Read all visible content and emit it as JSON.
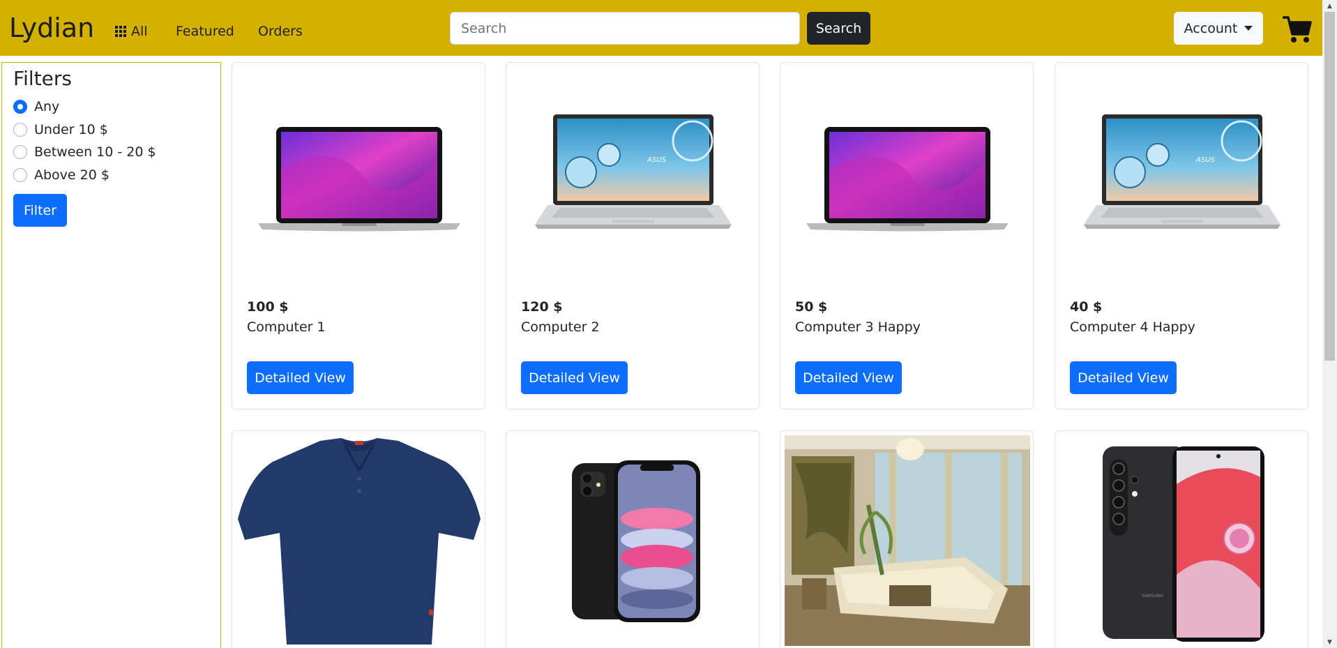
{
  "brand": "Lydian",
  "nav": {
    "all_label": "All",
    "featured_label": "Featured",
    "orders_label": "Orders"
  },
  "search": {
    "placeholder": "Search",
    "value": "",
    "button_label": "Search"
  },
  "account": {
    "label": "Account"
  },
  "icons": {
    "all": "grid-icon",
    "account_caret": "chevron-down-icon",
    "cart": "shopping-cart-icon"
  },
  "filters": {
    "title": "Filters",
    "options": [
      {
        "label": "Any",
        "checked": true
      },
      {
        "label": "Under 10 $",
        "checked": false
      },
      {
        "label": "Between 10 - 20 $",
        "checked": false
      },
      {
        "label": "Above 20 $",
        "checked": false
      }
    ],
    "button_label": "Filter"
  },
  "products": [
    {
      "price": "100 $",
      "name": "Computer 1",
      "button_label": "Detailed View",
      "image": "macbook"
    },
    {
      "price": "120 $",
      "name": "Computer 2",
      "button_label": "Detailed View",
      "image": "asus-laptop"
    },
    {
      "price": "50 $",
      "name": "Computer 3 Happy",
      "button_label": "Detailed View",
      "image": "macbook"
    },
    {
      "price": "40 $",
      "name": "Computer 4 Happy",
      "button_label": "Detailed View",
      "image": "asus-laptop"
    },
    {
      "image": "polo-shirt"
    },
    {
      "image": "iphone"
    },
    {
      "image": "living-room"
    },
    {
      "image": "samsung-phone"
    }
  ],
  "colors": {
    "navbar": "#d4b000",
    "primary": "#0d6efd",
    "dark": "#212529"
  }
}
